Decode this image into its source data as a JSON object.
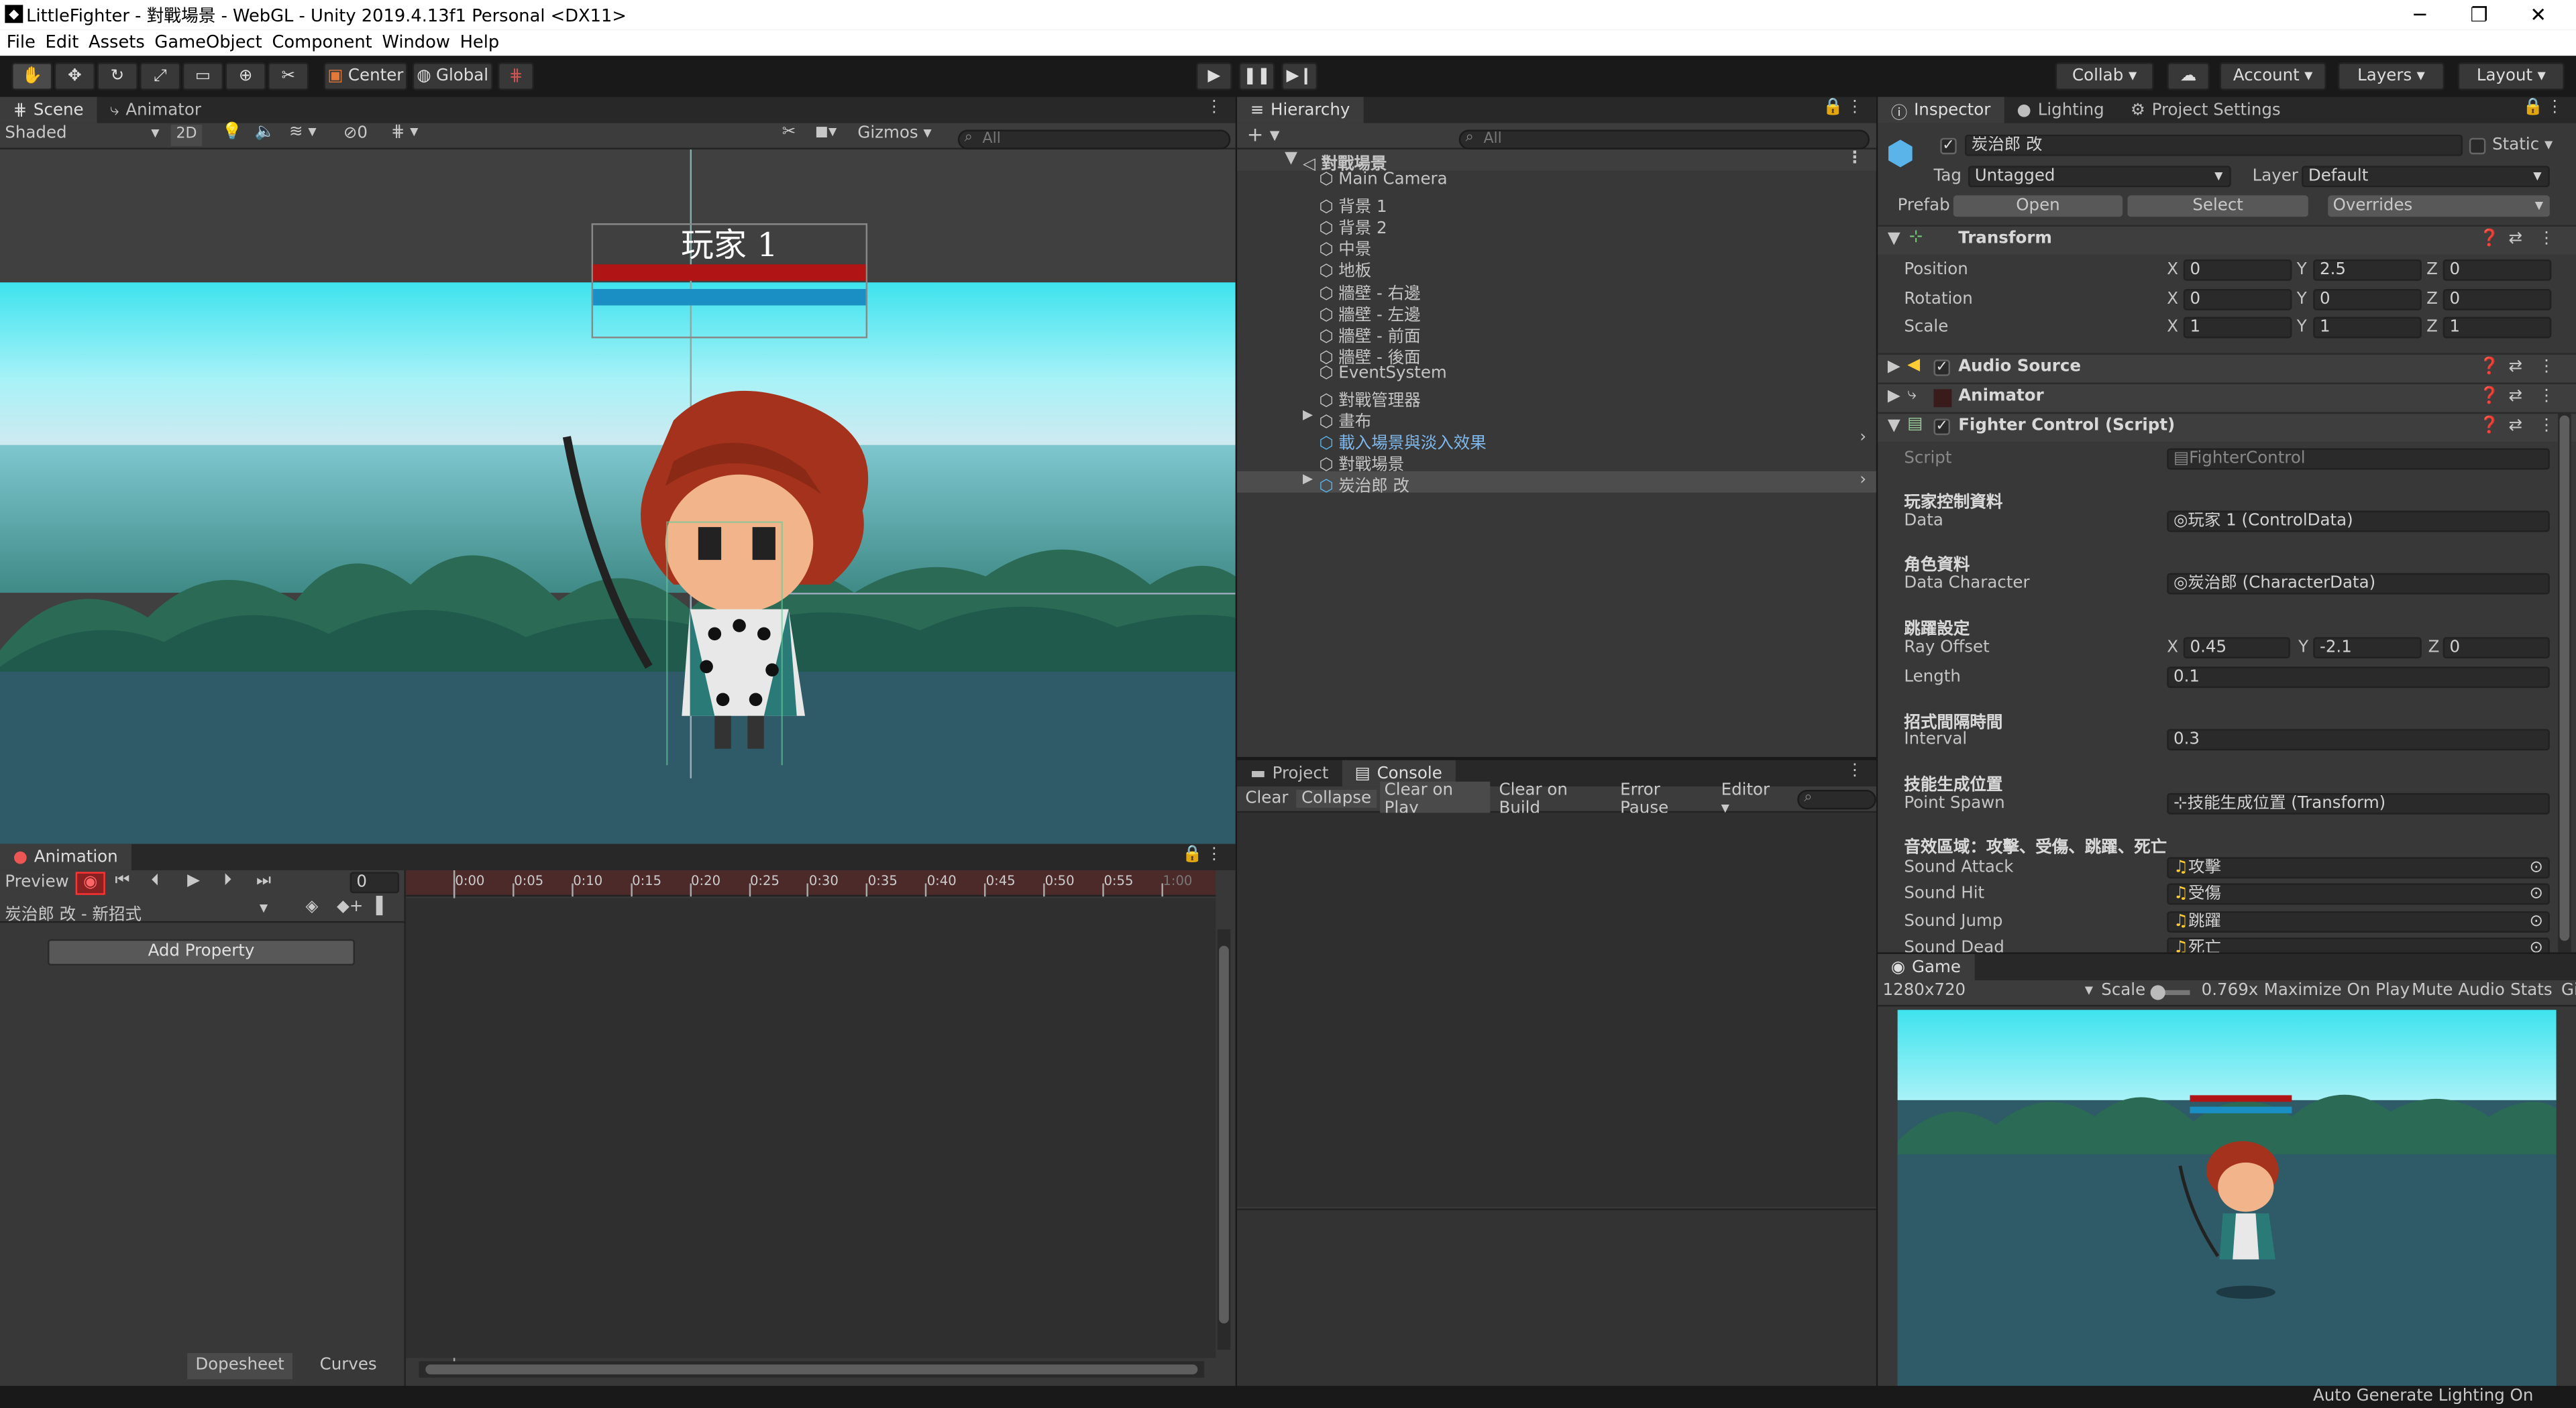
{
  "window": {
    "title": "LittleFighter - 對戰場景 - WebGL - Unity 2019.4.13f1 Personal <DX11>"
  },
  "menu": [
    "File",
    "Edit",
    "Assets",
    "GameObject",
    "Component",
    "Window",
    "Help"
  ],
  "toolbar": {
    "center": "Center",
    "global": "Global",
    "collab": "Collab ▾",
    "account": "Account",
    "layers": "Layers",
    "layout": "Layout"
  },
  "scene": {
    "tab_scene": "Scene",
    "tab_animator": "Animator",
    "shading": "Shaded",
    "mode2d": "2D",
    "hidden_count": "0",
    "gizmos": "Gizmos",
    "search_placeholder": "All",
    "player_label": "玩家 1"
  },
  "animation": {
    "tab": "Animation",
    "preview": "Preview",
    "frame": "0",
    "clip": "炭治郎 改 - 新招式",
    "add_property": "Add Property",
    "ticks": [
      "0:00",
      "0:05",
      "0:10",
      "0:15",
      "0:20",
      "0:25",
      "0:30",
      "0:35",
      "0:40",
      "0:45",
      "0:50",
      "0:55",
      "1:00"
    ],
    "dopesheet": "Dopesheet",
    "curves": "Curves"
  },
  "hierarchy": {
    "tab": "Hierarchy",
    "search_placeholder": "All",
    "scene": "對戰場景",
    "items": [
      {
        "label": "Main Camera"
      },
      {
        "label": "背景 1"
      },
      {
        "label": "背景 2"
      },
      {
        "label": "中景"
      },
      {
        "label": "地板"
      },
      {
        "label": "牆壁 - 右邊"
      },
      {
        "label": "牆壁 - 左邊"
      },
      {
        "label": "牆壁 - 前面"
      },
      {
        "label": "牆壁 - 後面"
      },
      {
        "label": "EventSystem"
      },
      {
        "label": "對戰管理器"
      },
      {
        "label": "畫布"
      },
      {
        "label": "載入場景與淡入效果"
      },
      {
        "label": "對戰場景"
      },
      {
        "label": "炭治郎 改"
      }
    ]
  },
  "console": {
    "tab_project": "Project",
    "tab_console": "Console",
    "buttons": [
      "Clear",
      "Collapse",
      "Clear on Play",
      "Clear on Build",
      "Error Pause",
      "Editor ▾"
    ]
  },
  "inspector": {
    "tab_inspector": "Inspector",
    "tab_lighting": "Lighting",
    "tab_settings": "Project Settings",
    "object_name": "炭治郎 改",
    "static": "Static",
    "tag_label": "Tag",
    "tag": "Untagged",
    "layer_label": "Layer",
    "layer": "Default",
    "prefab": "Prefab",
    "open": "Open",
    "select": "Select",
    "overrides": "Overrides",
    "transform": {
      "title": "Transform",
      "position": "Position",
      "rotation": "Rotation",
      "scale": "Scale",
      "pos": [
        "0",
        "2.5",
        "0"
      ],
      "rot": [
        "0",
        "0",
        "0"
      ],
      "scl": [
        "1",
        "1",
        "1"
      ]
    },
    "audio_source": "Audio Source",
    "animator": "Animator",
    "fighter": "Fighter Control (Script)",
    "script_label": "Script",
    "script": "FighterControl",
    "h_control": "玩家控制資料",
    "data_label": "Data",
    "data": "玩家 1 (ControlData)",
    "h_char": "角色資料",
    "char_label": "Data Character",
    "char": "炭治郎 (CharacterData)",
    "h_jump": "跳躍設定",
    "ray_label": "Ray Offset",
    "ray": [
      "0.45",
      "-2.1",
      "0"
    ],
    "length_label": "Length",
    "length": "0.1",
    "h_interval": "招式間隔時間",
    "interval_label": "Interval",
    "interval": "0.3",
    "h_spawn": "技能生成位置",
    "spawn_label": "Point Spawn",
    "spawn": "技能生成位置 (Transform)",
    "h_sound": "音效區域：攻擊、受傷、跳躍、死亡",
    "sounds": [
      {
        "label": "Sound Attack",
        "value": "攻擊"
      },
      {
        "label": "Sound Hit",
        "value": "受傷"
      },
      {
        "label": "Sound Jump",
        "value": "跳躍"
      },
      {
        "label": "Sound Dead",
        "value": "死亡"
      }
    ]
  },
  "game": {
    "tab": "Game",
    "resolution": "1280x720",
    "scale_label": "Scale",
    "scale": "0.769x",
    "maximize": "Maximize On Play",
    "mute": "Mute Audio",
    "stats": "Stats",
    "gizmos": "Gi"
  },
  "status": {
    "text": "Auto Generate Lighting On"
  },
  "colors": {
    "panel": "#383838",
    "sky": "#3ee3ee",
    "ground": "#2f5a68",
    "hp": "#b01414",
    "mp": "#1a8fc4",
    "accent": "#5b9bd8"
  }
}
